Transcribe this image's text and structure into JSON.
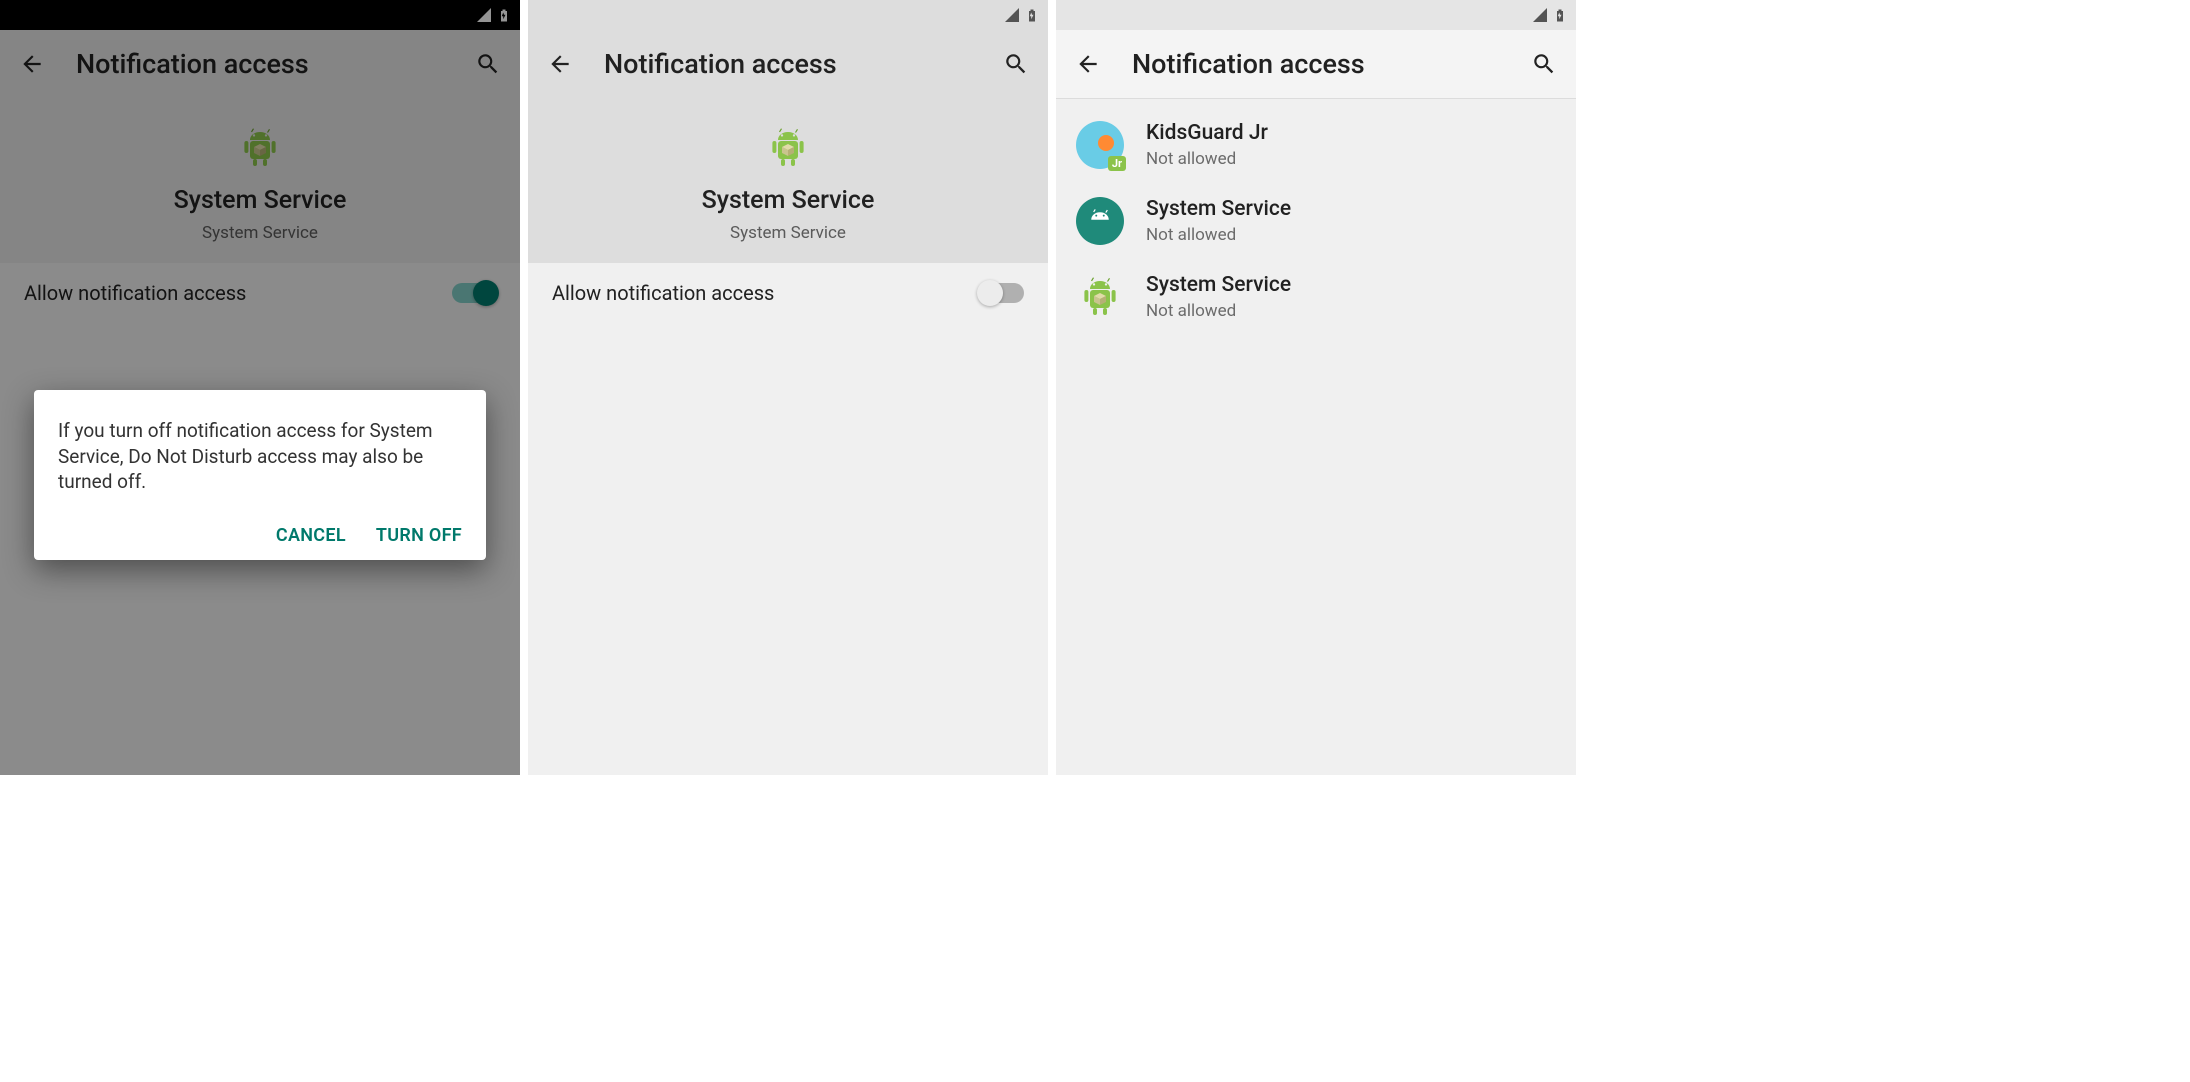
{
  "panel1": {
    "app_bar_title": "Notification access",
    "app_name": "System Service",
    "app_sub": "System Service",
    "toggle_label": "Allow notification access",
    "toggle_on": true,
    "dialog": {
      "body": "If you turn off notification access for System Service, Do Not Disturb access may also be turned off.",
      "cancel": "CANCEL",
      "confirm": "TURN OFF"
    }
  },
  "panel2": {
    "app_bar_title": "Notification access",
    "app_name": "System Service",
    "app_sub": "System Service",
    "toggle_label": "Allow notification access",
    "toggle_on": false
  },
  "panel3": {
    "app_bar_title": "Notification access",
    "apps": [
      {
        "name": "KidsGuard Jr",
        "status": "Not allowed",
        "icon": "kids"
      },
      {
        "name": "System Service",
        "status": "Not allowed",
        "icon": "sys-teal"
      },
      {
        "name": "System Service",
        "status": "Not allowed",
        "icon": "sys-droid"
      }
    ]
  }
}
